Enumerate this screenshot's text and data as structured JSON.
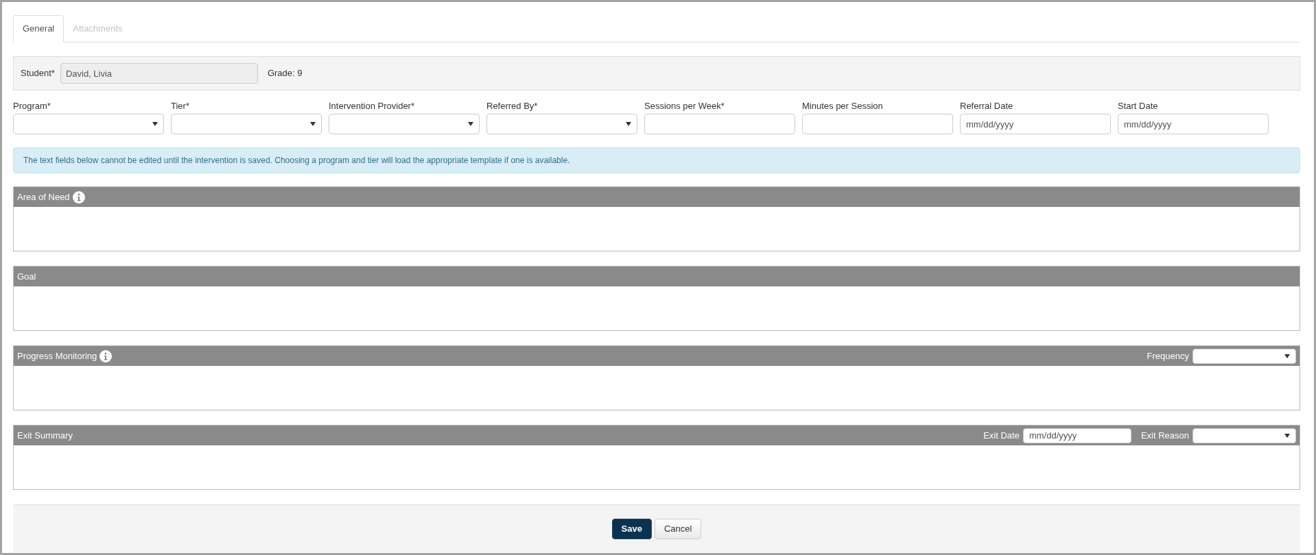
{
  "tabs": [
    {
      "label": "General",
      "selected": true
    },
    {
      "label": "Attachments",
      "selected": false
    }
  ],
  "student": {
    "label": "Student*",
    "value": "David, Livia",
    "grade": "Grade: 9"
  },
  "fields": [
    {
      "label": "Program*",
      "kind": "select"
    },
    {
      "label": "Tier*",
      "kind": "select"
    },
    {
      "label": "Intervention Provider*",
      "kind": "select"
    },
    {
      "label": "Referred By*",
      "kind": "select"
    },
    {
      "label": "Sessions per Week*",
      "kind": "text"
    },
    {
      "label": "Minutes per Session",
      "kind": "text"
    },
    {
      "label": "Referral Date",
      "kind": "text",
      "placeholder": "mm/dd/yyyy"
    },
    {
      "label": "Start Date",
      "kind": "text",
      "placeholder": "mm/dd/yyyy"
    }
  ],
  "notice": "The text fields below cannot be edited until the intervention is saved. Choosing a program and tier will load the appropriate template if one is available.",
  "sections": [
    {
      "title": "Area of Need",
      "info": true
    },
    {
      "title": "Goal",
      "info": false
    },
    {
      "title": "Progress Monitoring",
      "info": true,
      "controls": [
        {
          "label": "Frequency",
          "kind": "select"
        }
      ]
    },
    {
      "title": "Exit Summary",
      "info": false,
      "controls": [
        {
          "label": "Exit Date",
          "kind": "text",
          "placeholder": "mm/dd/yyyy"
        },
        {
          "label": "Exit Reason",
          "kind": "select"
        }
      ]
    }
  ],
  "buttons": [
    {
      "label": "Save",
      "kind": "primary"
    },
    {
      "label": "Cancel",
      "kind": "default"
    }
  ]
}
